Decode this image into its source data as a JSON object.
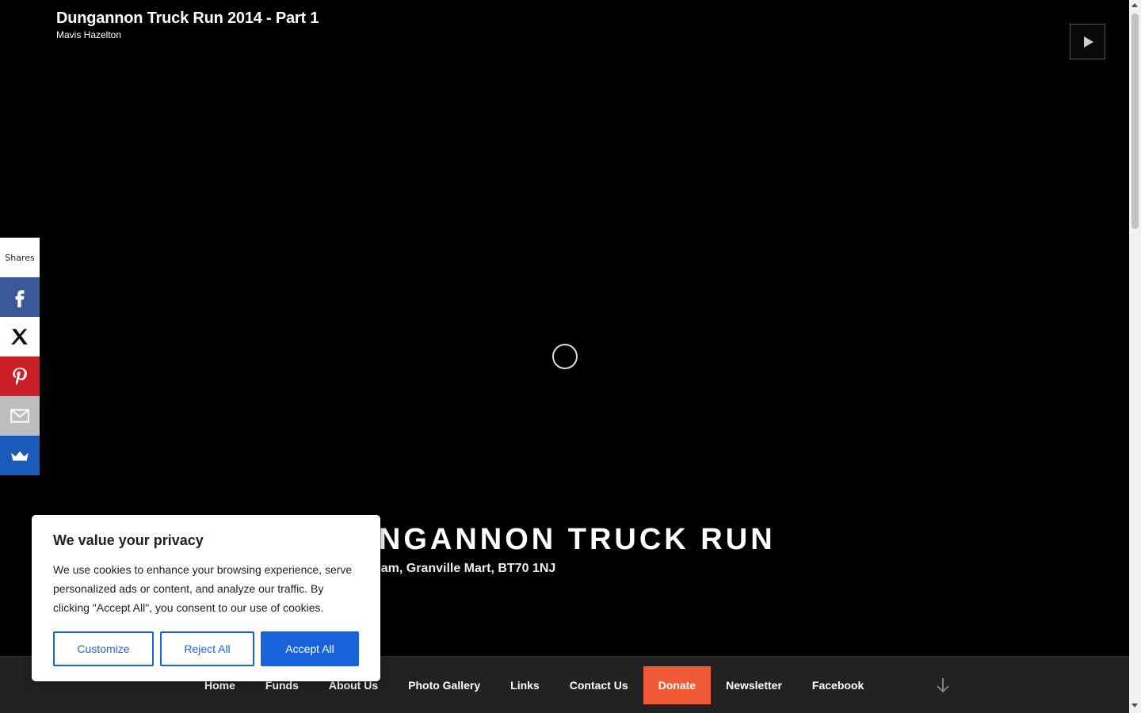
{
  "video": {
    "title": "Dungannon Truck Run 2014 - Part 1",
    "author": "Mavis Hazelton"
  },
  "hero": {
    "site_title": "DUNGANNON TRUCK RUN",
    "site_description": "Leaves 9:30am, Granville Mart, BT70 1NJ"
  },
  "share": {
    "count_label": "Shares",
    "buttons": [
      {
        "name": "facebook",
        "color": "#3b5998"
      },
      {
        "name": "x",
        "color": "#ffffff"
      },
      {
        "name": "pinterest",
        "color": "#cb2027"
      },
      {
        "name": "email",
        "color": "#bdbdbd"
      },
      {
        "name": "sumome",
        "color": "#1a5ab8"
      }
    ]
  },
  "nav": {
    "items": [
      {
        "label": "Home"
      },
      {
        "label": "Funds"
      },
      {
        "label": "About Us"
      },
      {
        "label": "Photo Gallery"
      },
      {
        "label": "Links"
      },
      {
        "label": "Contact Us"
      },
      {
        "label": "Donate"
      },
      {
        "label": "Newsletter"
      },
      {
        "label": "Facebook"
      }
    ],
    "donate_color": "#f05a36"
  },
  "cookie": {
    "title": "We value your privacy",
    "body": "We use cookies to enhance your browsing experience, serve personalized ads or content, and analyze our traffic. By clicking \"Accept All\", you consent to our use of cookies.",
    "customize_label": "Customize",
    "reject_label": "Reject All",
    "accept_label": "Accept All",
    "accent_color": "#1863dc"
  }
}
